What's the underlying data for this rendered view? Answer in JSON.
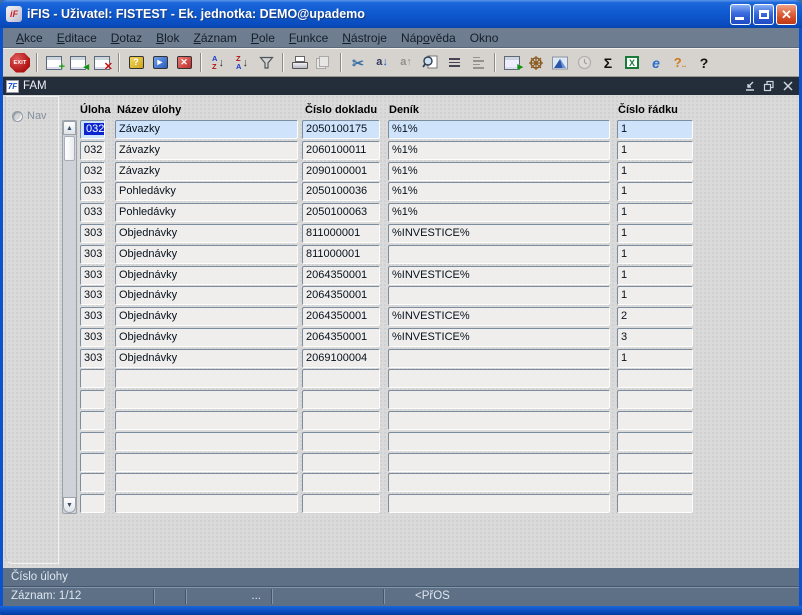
{
  "window": {
    "title": "iFIS - Uživatel: FISTEST - Ek. jednotka: DEMO@upademo",
    "app_icon_text": "iF",
    "buttons": {
      "minimize": "minimize",
      "maximize": "maximize",
      "close": "✕"
    }
  },
  "menubar": {
    "items": [
      {
        "label": "Akce",
        "mnemonic_index": 0
      },
      {
        "label": "Editace",
        "mnemonic_index": 0
      },
      {
        "label": "Dotaz",
        "mnemonic_index": 0
      },
      {
        "label": "Blok",
        "mnemonic_index": 0
      },
      {
        "label": "Záznam",
        "mnemonic_index": 0
      },
      {
        "label": "Pole",
        "mnemonic_index": 0
      },
      {
        "label": "Funkce",
        "mnemonic_index": 0
      },
      {
        "label": "Nástroje",
        "mnemonic_index": 0
      },
      {
        "label": "Nápověda",
        "mnemonic_index": 3
      },
      {
        "label": "Okno",
        "mnemonic_index": -1
      }
    ]
  },
  "toolbar": {
    "exit_label": "EXIT",
    "items": [
      {
        "icon": "exit-icon",
        "enabled": true
      },
      {
        "sep": true
      },
      {
        "icon": "insert-record-icon",
        "enabled": true
      },
      {
        "icon": "copy-record-icon",
        "enabled": true
      },
      {
        "icon": "delete-record-icon",
        "enabled": true
      },
      {
        "sep": true
      },
      {
        "icon": "enter-query-icon",
        "enabled": true
      },
      {
        "icon": "execute-query-icon",
        "enabled": true
      },
      {
        "icon": "cancel-query-icon",
        "enabled": true
      },
      {
        "sep": true
      },
      {
        "icon": "sort-asc-icon",
        "enabled": true
      },
      {
        "icon": "sort-desc-icon",
        "enabled": true
      },
      {
        "icon": "filter-icon",
        "enabled": true
      },
      {
        "sep": true
      },
      {
        "icon": "print-icon",
        "enabled": true
      },
      {
        "icon": "print-preview-icon",
        "enabled": false
      },
      {
        "sep": true
      },
      {
        "icon": "cut-icon",
        "enabled": true
      },
      {
        "icon": "copy-field-down-icon",
        "enabled": true
      },
      {
        "icon": "copy-field-up-icon",
        "enabled": false
      },
      {
        "icon": "find-icon",
        "enabled": true
      },
      {
        "icon": "editor-icon",
        "enabled": true
      },
      {
        "icon": "list-values-icon",
        "enabled": false
      },
      {
        "sep": true
      },
      {
        "icon": "lov-form-icon",
        "enabled": true
      },
      {
        "icon": "helm-icon",
        "enabled": true
      },
      {
        "icon": "mountain-icon",
        "enabled": true
      },
      {
        "icon": "clock-icon",
        "enabled": false
      },
      {
        "icon": "sigma-icon",
        "enabled": true
      },
      {
        "icon": "excel-icon",
        "enabled": true
      },
      {
        "icon": "browser-icon",
        "enabled": true
      },
      {
        "icon": "context-help-icon",
        "enabled": true
      },
      {
        "icon": "help-icon",
        "enabled": true
      }
    ]
  },
  "mdi": {
    "title": "FAM",
    "icon_text": "7F",
    "buttons": {
      "minimize": "minimize",
      "restore": "restore",
      "close": "✕"
    }
  },
  "nav": {
    "label": "Nav"
  },
  "table": {
    "columns": [
      "Úloha",
      "Název úlohy",
      "Číslo dokladu",
      "Deník",
      "Číslo řádku"
    ],
    "rows": [
      {
        "uloha": "032",
        "nazev": "Závazky",
        "doklad": "2050100175",
        "denik": "%1%",
        "radek": "1",
        "highlighted": true,
        "uloha_selected": true
      },
      {
        "uloha": "032",
        "nazev": "Závazky",
        "doklad": "2060100011",
        "denik": "%1%",
        "radek": "1"
      },
      {
        "uloha": "032",
        "nazev": "Závazky",
        "doklad": "2090100001",
        "denik": "%1%",
        "radek": "1"
      },
      {
        "uloha": "033",
        "nazev": "Pohledávky",
        "doklad": "2050100036",
        "denik": "%1%",
        "radek": "1"
      },
      {
        "uloha": "033",
        "nazev": "Pohledávky",
        "doklad": "2050100063",
        "denik": "%1%",
        "radek": "1"
      },
      {
        "uloha": "303",
        "nazev": "Objednávky",
        "doklad": "811000001",
        "denik": "%INVESTICE%",
        "radek": "1"
      },
      {
        "uloha": "303",
        "nazev": "Objednávky",
        "doklad": "811000001",
        "denik": "",
        "radek": "1"
      },
      {
        "uloha": "303",
        "nazev": "Objednávky",
        "doklad": "2064350001",
        "denik": "%INVESTICE%",
        "radek": "1"
      },
      {
        "uloha": "303",
        "nazev": "Objednávky",
        "doklad": "2064350001",
        "denik": "",
        "radek": "1"
      },
      {
        "uloha": "303",
        "nazev": "Objednávky",
        "doklad": "2064350001",
        "denik": "%INVESTICE%",
        "radek": "2"
      },
      {
        "uloha": "303",
        "nazev": "Objednávky",
        "doklad": "2064350001",
        "denik": "%INVESTICE%",
        "radek": "3"
      },
      {
        "uloha": "303",
        "nazev": "Objednávky",
        "doklad": "2069100004",
        "denik": "",
        "radek": "1"
      },
      {
        "uloha": "",
        "nazev": "",
        "doklad": "",
        "denik": "",
        "radek": ""
      },
      {
        "uloha": "",
        "nazev": "",
        "doklad": "",
        "denik": "",
        "radek": ""
      },
      {
        "uloha": "",
        "nazev": "",
        "doklad": "",
        "denik": "",
        "radek": ""
      },
      {
        "uloha": "",
        "nazev": "",
        "doklad": "",
        "denik": "",
        "radek": ""
      },
      {
        "uloha": "",
        "nazev": "",
        "doklad": "",
        "denik": "",
        "radek": ""
      },
      {
        "uloha": "",
        "nazev": "",
        "doklad": "",
        "denik": "",
        "radek": ""
      },
      {
        "uloha": "",
        "nazev": "",
        "doklad": "",
        "denik": "",
        "radek": ""
      }
    ]
  },
  "statusbar": {
    "hint": "Číslo úlohy",
    "record": "Záznam: 1/12",
    "dots": "...",
    "mode": "<PřOS"
  },
  "colors": {
    "titlebar_blue": "#0f5ad0",
    "menubar_slate": "#6e7d8f",
    "toolbar_gray": "#d6d3ce",
    "mdi_titlebar": "#242e3b",
    "canvas_gray": "#dadada",
    "row_highlight": "#cfe4fb",
    "cell_bg": "#efeeec",
    "selection_blue": "#0a24cf",
    "statusbar_slate": "#5e7085",
    "window_border_blue": "#0c52cc"
  }
}
